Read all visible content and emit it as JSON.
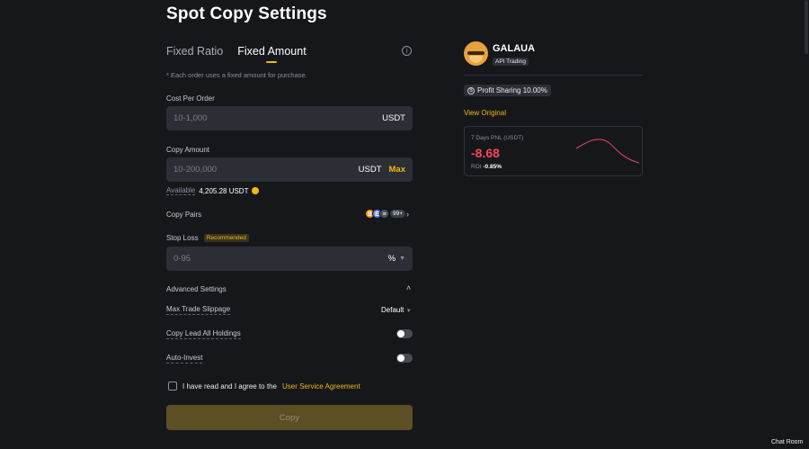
{
  "page": {
    "title": "Spot Copy Settings"
  },
  "tabs": [
    {
      "label": "Fixed Ratio",
      "active": false
    },
    {
      "label": "Fixed Amount",
      "active": true
    }
  ],
  "note": "* Each order uses a fixed amount for purchase.",
  "cost_per_order": {
    "label": "Cost Per Order",
    "placeholder": "10-1,000",
    "unit": "USDT"
  },
  "copy_amount": {
    "label": "Copy Amount",
    "placeholder": "10-200,000",
    "unit": "USDT",
    "max_label": "Max"
  },
  "available": {
    "label": "Available",
    "value": "4,205.28 USDT"
  },
  "copy_pairs": {
    "label": "Copy Pairs",
    "coins": [
      "B",
      "E",
      "≡"
    ],
    "more": "99+"
  },
  "stop_loss": {
    "label": "Stop Loss",
    "badge": "Recommended",
    "placeholder": "0-95",
    "unit": "%"
  },
  "advanced": {
    "title": "Advanced Settings",
    "max_slippage": {
      "label": "Max Trade Slippage",
      "value": "Default"
    },
    "copy_lead": {
      "label": "Copy Lead All Holdings",
      "enabled": false
    },
    "auto_invest": {
      "label": "Auto-Invest",
      "enabled": false
    }
  },
  "agreement": {
    "text": "I have read and I agree to the",
    "link": "User Service Agreement",
    "checked": false
  },
  "copy_button": {
    "label": "Copy"
  },
  "trader": {
    "name": "GALAUA",
    "badge": "API Trading",
    "profit_sharing": "Profit Sharing 10.00%",
    "view_original": "View Original",
    "pnl_label": "7 Days PNL (USDT)",
    "pnl_value": "-8.68",
    "roi_label": "ROI",
    "roi_value": "-0.85%"
  },
  "chat_room": "Chat Room",
  "colors": {
    "accent": "#f0b90b",
    "negative": "#f6465d",
    "background": "#16171b",
    "field": "#2b2e35"
  }
}
